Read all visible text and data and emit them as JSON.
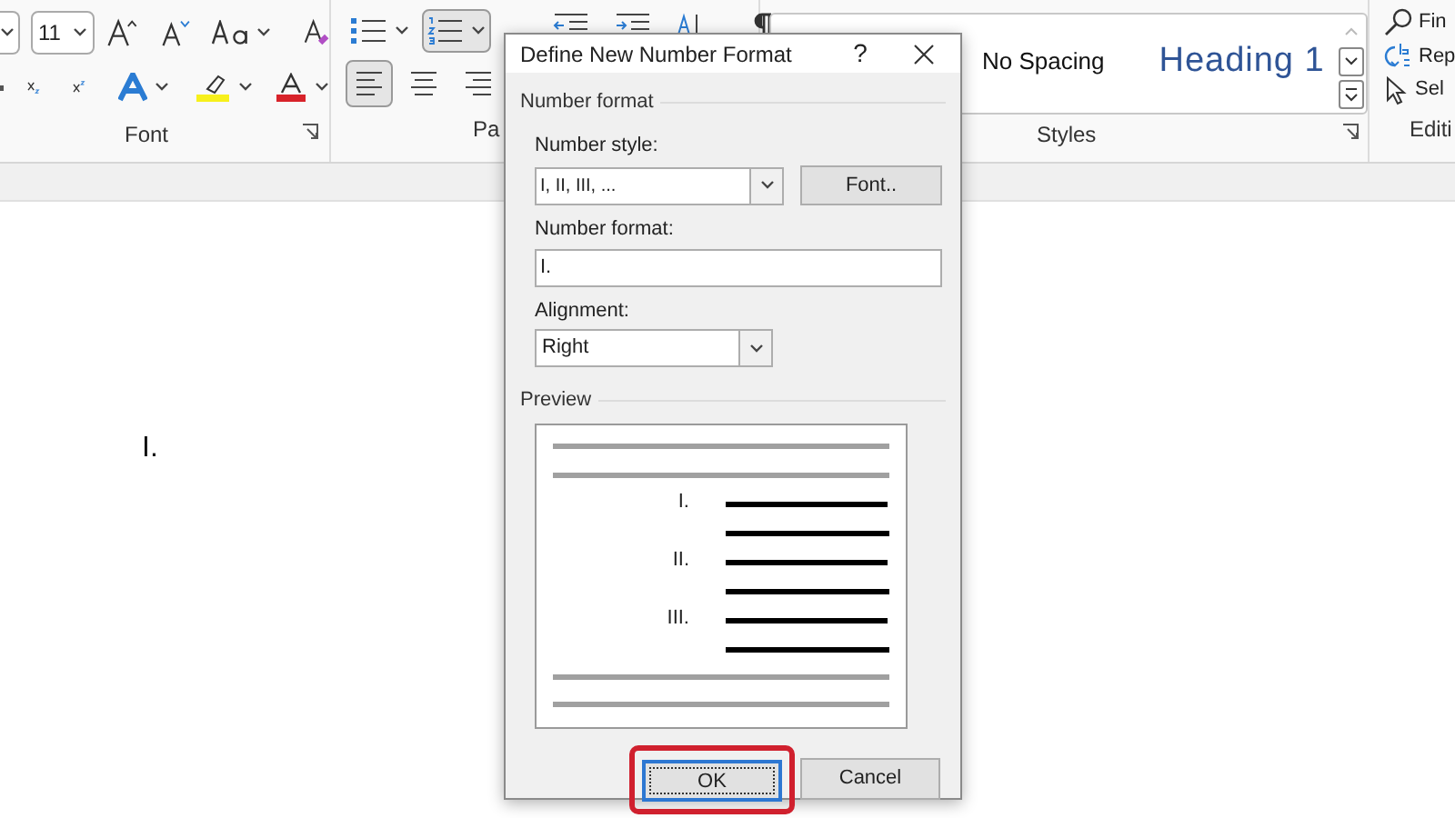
{
  "ribbon": {
    "font_size": "11",
    "groups": [
      {
        "label": "Font"
      },
      {
        "label": "Pa"
      },
      {
        "label": "Styles"
      },
      {
        "label": "Editi"
      }
    ],
    "styles": [
      "No Spacing",
      "Heading 1"
    ],
    "editing": [
      "Fin",
      "Rep",
      "Sel"
    ],
    "paragraph_buttons": [
      {
        "kind": "bullets",
        "selected": false
      },
      {
        "kind": "numbering",
        "selected": true
      }
    ],
    "align_buttons": [
      {
        "kind": "left",
        "selected": true
      },
      {
        "kind": "center",
        "selected": false
      },
      {
        "kind": "right",
        "selected": false
      }
    ]
  },
  "document": {
    "text": "I."
  },
  "dialog": {
    "title": "Define New Number Format",
    "help": "?",
    "section": "Number format",
    "number_style": {
      "label": "Number style:",
      "value": "I, II, III, ..."
    },
    "font_button": "Font..",
    "number_format": {
      "label": "Number format:",
      "value": "I."
    },
    "alignment": {
      "label": "Alignment:",
      "value": "Right"
    },
    "preview": {
      "label": "Preview",
      "numbers": [
        "I.",
        "II.",
        "III."
      ]
    },
    "buttons": [
      {
        "label": "OK",
        "default": true,
        "highlighted": true
      },
      {
        "label": "Cancel",
        "default": false,
        "highlighted": false
      }
    ]
  }
}
